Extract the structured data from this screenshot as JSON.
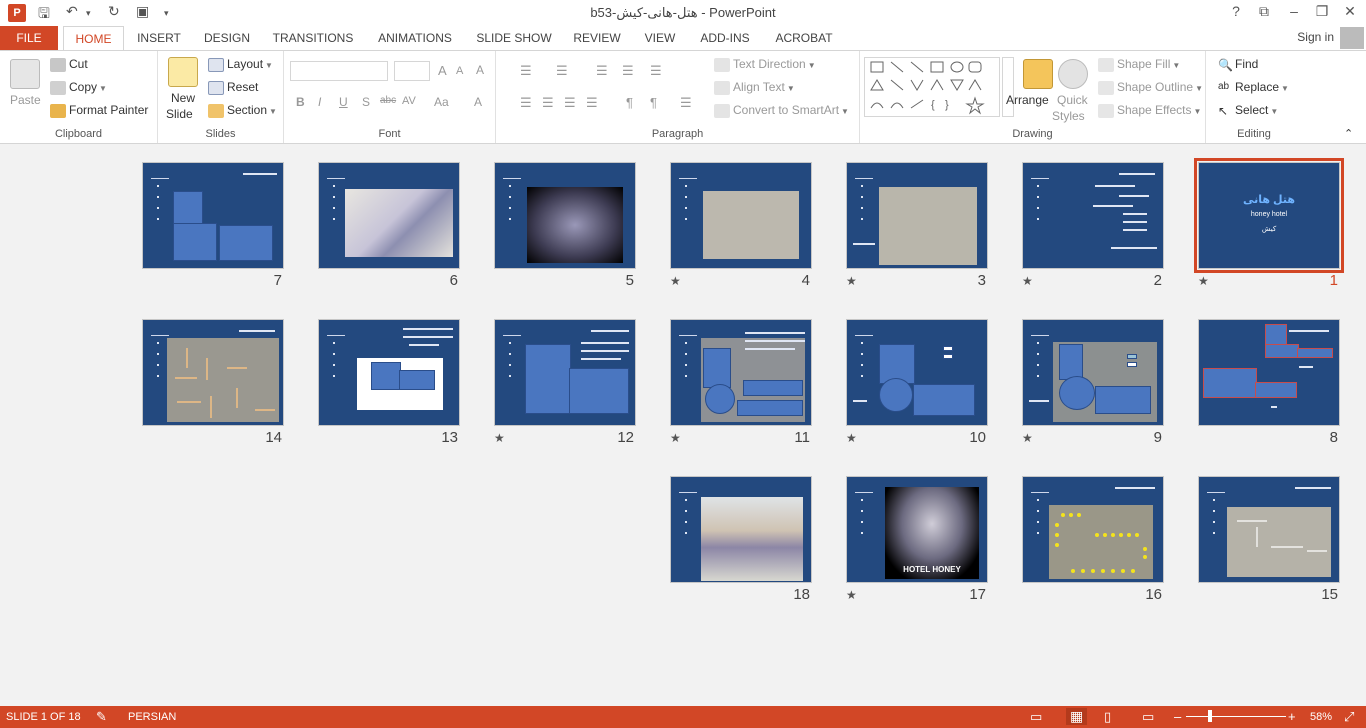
{
  "window": {
    "title": "b53-هتل-هانی-کیش - PowerPoint",
    "app_icon": "P",
    "controls": [
      "?",
      "⧉",
      "–",
      "❐",
      "✕"
    ]
  },
  "tabs": {
    "file": "FILE",
    "home": "HOME",
    "insert": "INSERT",
    "design": "DESIGN",
    "transitions": "TRANSITIONS",
    "animations": "ANIMATIONS",
    "slide_show": "SLIDE SHOW",
    "review": "REVIEW",
    "view": "VIEW",
    "add_ins": "ADD-INS",
    "acrobat": "ACROBAT",
    "sign_in": "Sign in"
  },
  "ribbon": {
    "clipboard": {
      "label": "Clipboard",
      "paste": "Paste",
      "cut": "Cut",
      "copy": "Copy",
      "format_painter": "Format Painter"
    },
    "slides": {
      "label": "Slides",
      "new_slide_1": "New",
      "new_slide_2": "Slide",
      "layout": "Layout",
      "reset": "Reset",
      "section": "Section"
    },
    "font": {
      "label": "Font",
      "bold": "B",
      "italic": "I",
      "underline": "U",
      "shadow": "S",
      "strike": "abc",
      "spacing": "AV",
      "case": "Aa",
      "grow": "A",
      "shrink": "A",
      "clear": "A"
    },
    "paragraph": {
      "label": "Paragraph",
      "text_direction": "Text Direction",
      "align_text": "Align Text",
      "convert_smartart": "Convert to SmartArt"
    },
    "drawing": {
      "label": "Drawing",
      "arrange": "Arrange",
      "quick_styles_1": "Quick",
      "quick_styles_2": "Styles",
      "shape_fill": "Shape Fill",
      "shape_outline": "Shape Outline",
      "shape_effects": "Shape Effects"
    },
    "editing": {
      "label": "Editing",
      "find": "Find",
      "replace": "Replace",
      "select": "Select"
    }
  },
  "slides": [
    {
      "n": "1",
      "star": true,
      "selected": true,
      "title": "هتل هانی",
      "subtitle": "honey hotel",
      "city": "کیش"
    },
    {
      "n": "2",
      "star": true
    },
    {
      "n": "3",
      "star": true
    },
    {
      "n": "4",
      "star": true
    },
    {
      "n": "5",
      "star": false
    },
    {
      "n": "6",
      "star": false
    },
    {
      "n": "7",
      "star": false
    },
    {
      "n": "8",
      "star": false
    },
    {
      "n": "9",
      "star": true
    },
    {
      "n": "10",
      "star": true
    },
    {
      "n": "11",
      "star": true
    },
    {
      "n": "12",
      "star": true
    },
    {
      "n": "13",
      "star": false
    },
    {
      "n": "14",
      "star": false
    },
    {
      "n": "15",
      "star": false
    },
    {
      "n": "16",
      "star": false
    },
    {
      "n": "17",
      "star": true,
      "caption": "HOTEL HONEY"
    },
    {
      "n": "18",
      "star": false
    }
  ],
  "star_glyph": "★",
  "status": {
    "slide_info": "SLIDE 1 OF 18",
    "language": "PERSIAN",
    "zoom": "58%",
    "minus": "–",
    "plus": "+"
  },
  "colors": {
    "accent": "#d24726",
    "slide_bg": "#23497f",
    "sorter_bg": "#f2f2f2"
  }
}
